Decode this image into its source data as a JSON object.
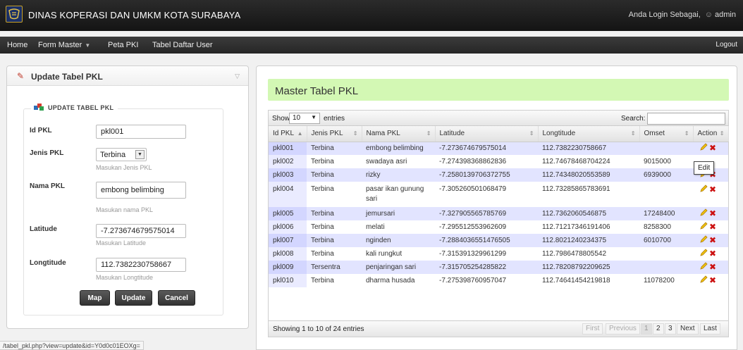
{
  "header": {
    "app_title": "DINAS KOPERASI DAN UMKM KOTA SURABAYA",
    "login_label": "Anda Login Sebagai,",
    "user": "admin"
  },
  "menu": {
    "home": "Home",
    "form_master": "Form Master",
    "peta": "Peta PKI",
    "tabel_user": "Tabel Daftar User",
    "logout": "Logout"
  },
  "form_panel": {
    "title": "Update Tabel PKL",
    "legend": "UPDATE TABEL PKL",
    "id_label": "Id PKL",
    "id_value": "pkl001",
    "jenis_label": "Jenis PKL",
    "jenis_value": "Terbina",
    "jenis_help": "Masukan Jenis PKL",
    "nama_label": "Nama PKL",
    "nama_value": "embong belimbing",
    "nama_help": "Masukan nama PKL",
    "lat_label": "Latitude",
    "lat_value": "-7.273674679575014",
    "lat_help": "Masukan Latitude",
    "lng_label": "Longtitude",
    "lng_value": "112.7382230758667",
    "lng_help": "Masukan Longtitude",
    "btn_map": "Map",
    "btn_update": "Update",
    "btn_cancel": "Cancel"
  },
  "status_url": "/tabel_pkl.php?view=update&id=Y0d0c01EOXg=",
  "master": {
    "title": "Master Tabel PKL",
    "show_label": "Show",
    "show_value": "10",
    "entries_label": "entries",
    "search_label": "Search:",
    "columns": [
      "Id PKL",
      "Jenis PKL",
      "Nama PKL",
      "Latitude",
      "Longtitude",
      "Omset",
      "Action"
    ],
    "rows": [
      {
        "id": "pkl001",
        "jenis": "Terbina",
        "nama": "embong belimbing",
        "lat": "-7.273674679575014",
        "lng": "112.7382230758667",
        "omset": ""
      },
      {
        "id": "pkl002",
        "jenis": "Terbina",
        "nama": "swadaya asri",
        "lat": "-7.274398368862836",
        "lng": "112.74678468704224",
        "omset": "9015000"
      },
      {
        "id": "pkl003",
        "jenis": "Terbina",
        "nama": "rizky",
        "lat": "-7.2580139706372755",
        "lng": "112.74348020553589",
        "omset": "6939000"
      },
      {
        "id": "pkl004",
        "jenis": "Terbina",
        "nama": "pasar ikan gunung sari",
        "lat": "-7.305260501068479",
        "lng": "112.73285865783691",
        "omset": ""
      },
      {
        "id": "pkl005",
        "jenis": "Terbina",
        "nama": "jemursari",
        "lat": "-7.327905565785769",
        "lng": "112.7362060546875",
        "omset": "17248400"
      },
      {
        "id": "pkl006",
        "jenis": "Terbina",
        "nama": "melati",
        "lat": "-7.295512553962609",
        "lng": "112.71217346191406",
        "omset": "8258300"
      },
      {
        "id": "pkl007",
        "jenis": "Terbina",
        "nama": "nginden",
        "lat": "-7.2884036551476505",
        "lng": "112.8021240234375",
        "omset": "6010700"
      },
      {
        "id": "pkl008",
        "jenis": "Terbina",
        "nama": "kali rungkut",
        "lat": "-7.315391329961299",
        "lng": "112.7986478805542",
        "omset": ""
      },
      {
        "id": "pkl009",
        "jenis": "Tersentra",
        "nama": "penjaringan sari",
        "lat": "-7.315705254285822",
        "lng": "112.78208792209625",
        "omset": ""
      },
      {
        "id": "pkl010",
        "jenis": "Terbina",
        "nama": "dharma husada",
        "lat": "-7.275398760957047",
        "lng": "112.74641454219818",
        "omset": "11078200"
      }
    ],
    "tooltip": "Edit",
    "info": "Showing 1 to 10 of 24 entries",
    "pager": {
      "first": "First",
      "previous": "Previous",
      "p1": "1",
      "p2": "2",
      "p3": "3",
      "next": "Next",
      "last": "Last"
    }
  },
  "icons": {
    "edit": "pencil-icon",
    "delete": "delete-x-icon",
    "user": "user-icon"
  },
  "colors": {
    "title_bg": "#d3f8b4",
    "odd_row": "#e2e4ff",
    "delete": "#cc1111"
  }
}
